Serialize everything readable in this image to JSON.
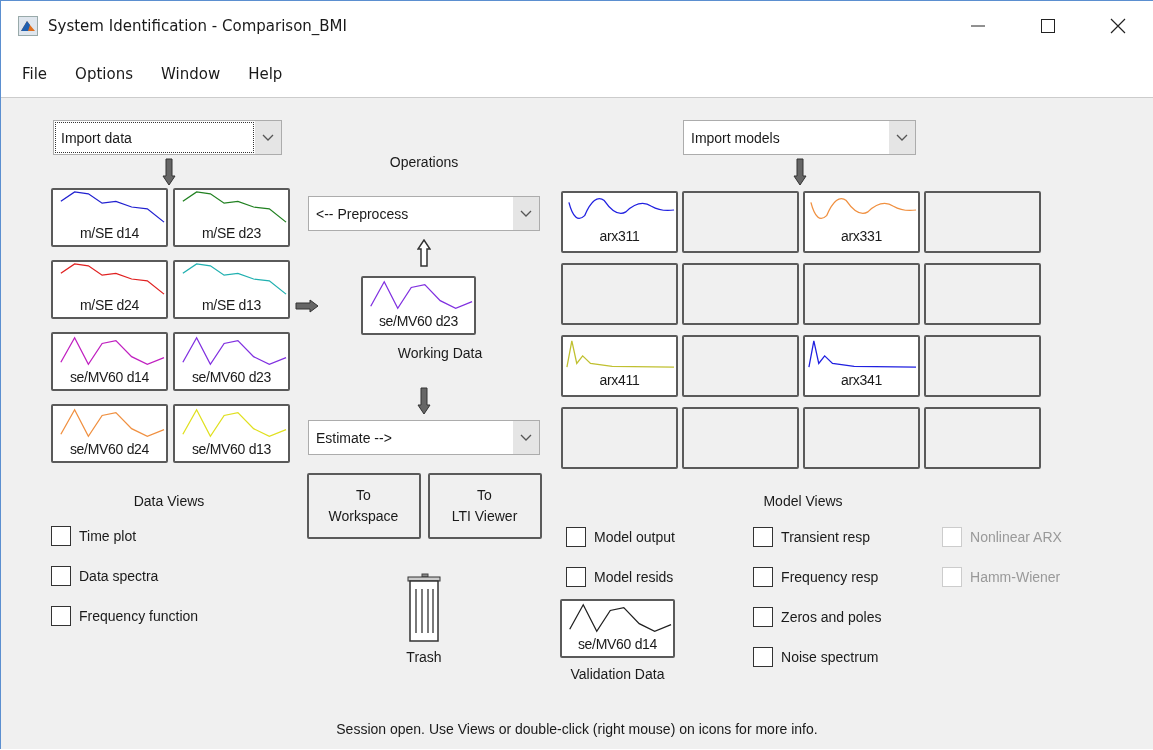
{
  "window": {
    "title": "System Identification - Comparison_BMI"
  },
  "menu": [
    "File",
    "Options",
    "Window",
    "Help"
  ],
  "data_import": {
    "value": "Import data",
    "focused": true
  },
  "data_tiles": [
    {
      "label": "m/SE d14",
      "color": "#2020d0",
      "kind": "decline"
    },
    {
      "label": "m/SE d23",
      "color": "#208020",
      "kind": "decline"
    },
    {
      "label": "m/SE d24",
      "color": "#e02020",
      "kind": "decline"
    },
    {
      "label": "m/SE d13",
      "color": "#20b0b0",
      "kind": "decline"
    },
    {
      "label": "se/MV60 d14",
      "color": "#c020c0",
      "kind": "zigzag"
    },
    {
      "label": "se/MV60 d23",
      "color": "#8030e0",
      "kind": "zigzag"
    },
    {
      "label": "se/MV60 d24",
      "color": "#f09040",
      "kind": "zigzag"
    },
    {
      "label": "se/MV60 d13",
      "color": "#e0e020",
      "kind": "zigzag"
    }
  ],
  "operations": {
    "title": "Operations",
    "preprocess": "<-- Preprocess",
    "working_data": {
      "label": "se/MV60 d23",
      "color": "#8030e0",
      "kind": "zigzag"
    },
    "working_title": "Working Data",
    "estimate": "Estimate -->"
  },
  "buttons": [
    {
      "line1": "To",
      "line2": "Workspace"
    },
    {
      "line1": "To",
      "line2": "LTI Viewer"
    }
  ],
  "trash": {
    "label": "Trash"
  },
  "data_views": {
    "title": "Data Views",
    "options": [
      {
        "label": "Time plot",
        "checked": false
      },
      {
        "label": "Data spectra",
        "checked": false
      },
      {
        "label": "Frequency function",
        "checked": false
      }
    ]
  },
  "model_import": {
    "value": "Import models",
    "focused": false
  },
  "model_tiles": [
    {
      "kind": "wave",
      "label": "arx311",
      "color": "#2020e0"
    },
    {
      "kind": "empty"
    },
    {
      "kind": "wave",
      "label": "arx331",
      "color": "#f09040"
    },
    {
      "kind": "empty"
    },
    {
      "kind": "empty"
    },
    {
      "kind": "empty"
    },
    {
      "kind": "empty"
    },
    {
      "kind": "empty"
    },
    {
      "kind": "impulse",
      "label": "arx411",
      "color": "#c0c030"
    },
    {
      "kind": "empty"
    },
    {
      "kind": "impulse",
      "label": "arx341",
      "color": "#2020e0"
    },
    {
      "kind": "empty"
    },
    {
      "kind": "empty"
    },
    {
      "kind": "empty"
    },
    {
      "kind": "empty"
    },
    {
      "kind": "empty"
    }
  ],
  "model_views": {
    "title": "Model Views",
    "columns": [
      {
        "options": [
          {
            "label": "Model output",
            "checked": false,
            "disabled": false
          },
          {
            "label": "Model resids",
            "checked": false,
            "disabled": false
          }
        ]
      },
      {
        "options": [
          {
            "label": "Transient resp",
            "checked": false,
            "disabled": false
          },
          {
            "label": "Frequency resp",
            "checked": false,
            "disabled": false
          },
          {
            "label": "Zeros and poles",
            "checked": false,
            "disabled": false
          },
          {
            "label": "Noise spectrum",
            "checked": false,
            "disabled": false
          }
        ]
      },
      {
        "options": [
          {
            "label": "Nonlinear ARX",
            "checked": false,
            "disabled": true
          },
          {
            "label": "Hamm-Wiener",
            "checked": false,
            "disabled": true
          }
        ]
      }
    ]
  },
  "validation_data": {
    "label": "se/MV60 d14",
    "color": "#202020",
    "kind": "zigzag",
    "title": "Validation Data"
  },
  "status_bar": "Session open. Use Views or double-click (right mouse) on icons for more info."
}
